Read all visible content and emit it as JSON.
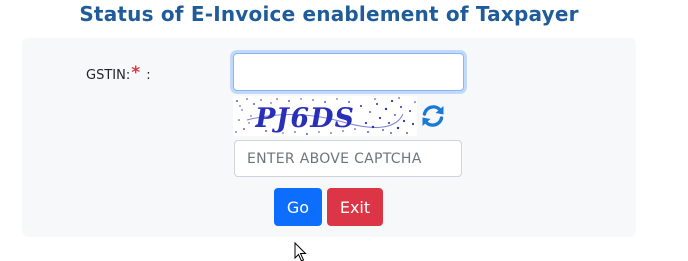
{
  "title": "Status of E-Invoice enablement of Taxpayer",
  "form": {
    "gstin_label": "GSTIN:",
    "required_mark": "*",
    "label_separator": ":",
    "gstin_value": "",
    "captcha_text": "PJ6DS",
    "captcha_placeholder": "ENTER ABOVE CAPTCHA",
    "refresh_icon": "refresh-icon"
  },
  "buttons": {
    "go_label": "Go",
    "exit_label": "Exit"
  },
  "colors": {
    "title": "#1f5c99",
    "go": "#0d6efd",
    "exit": "#dc3545",
    "required": "#dc3545",
    "captcha_text": "#2a2fb8"
  }
}
